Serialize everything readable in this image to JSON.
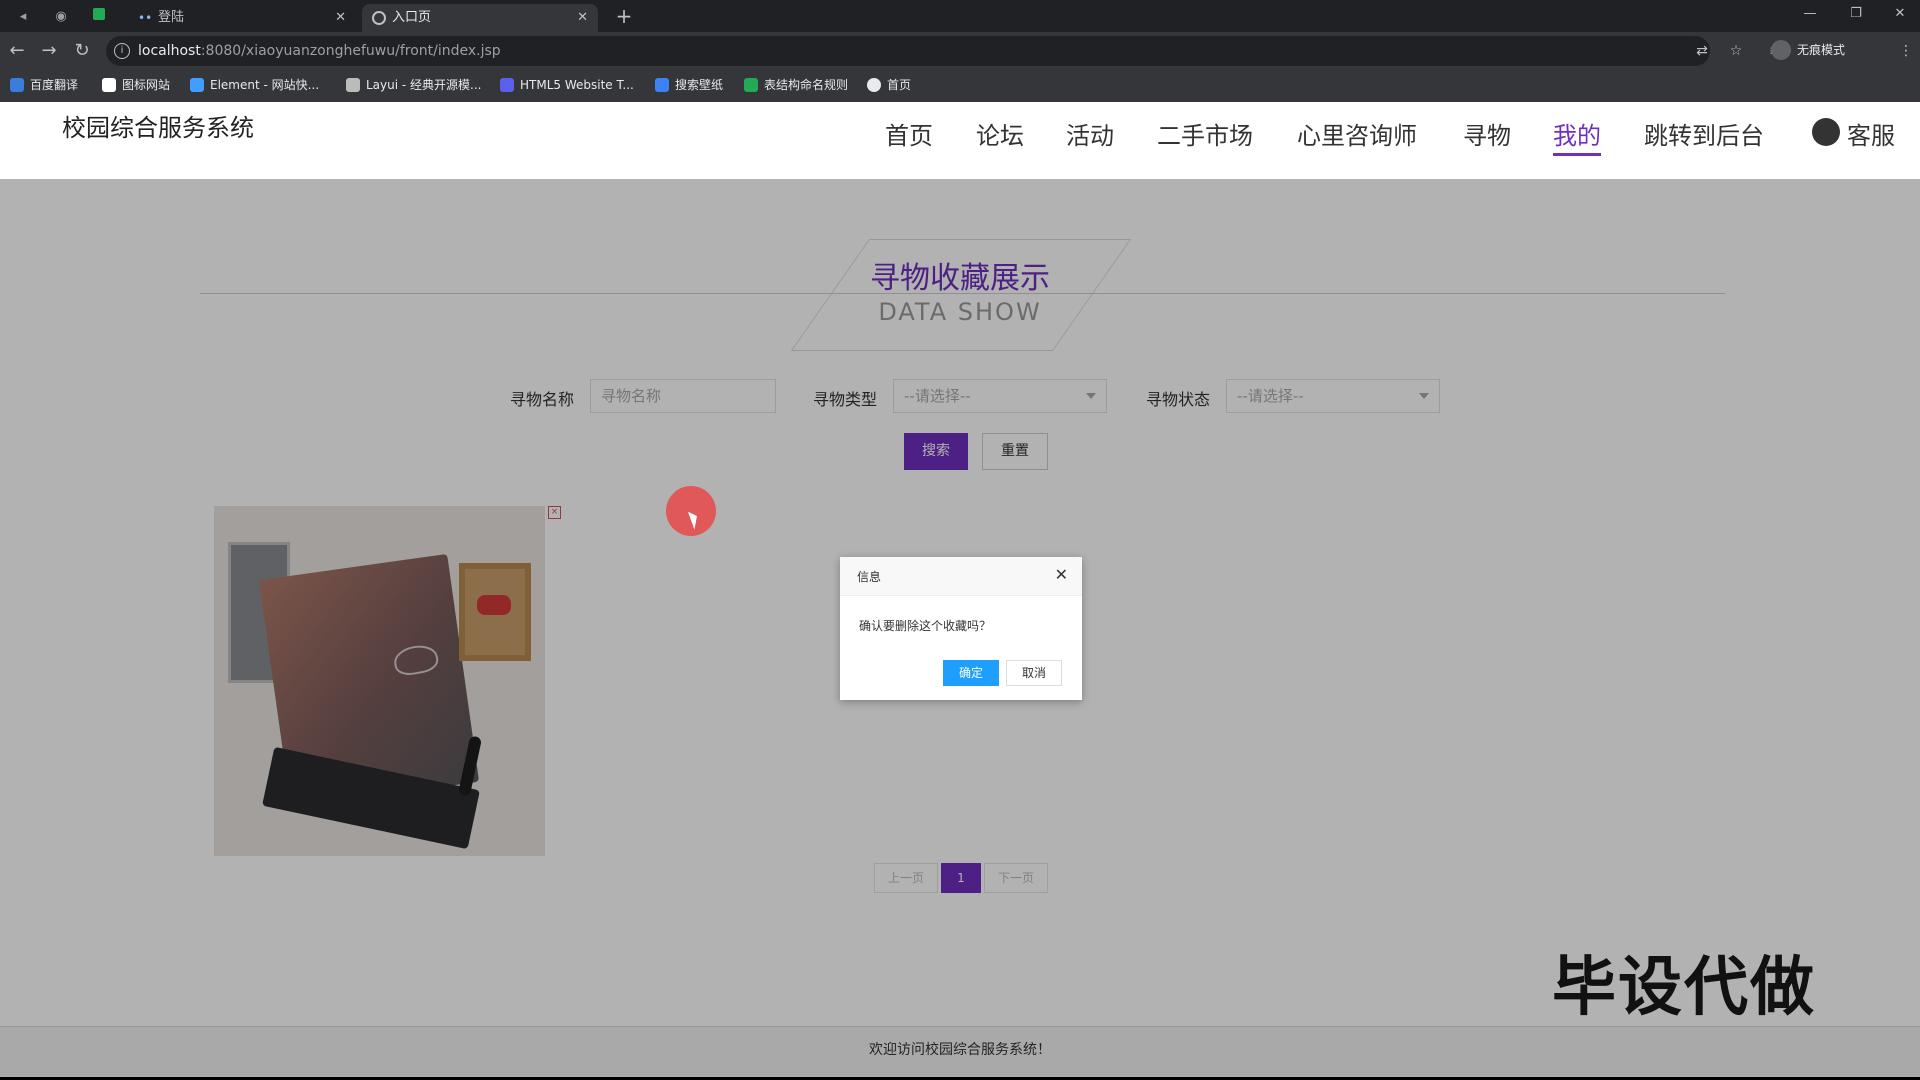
{
  "browser": {
    "tabs": [
      {
        "label": "登陆",
        "active": false
      },
      {
        "label": "入口页",
        "active": true
      }
    ],
    "new_tab_symbol": "+",
    "url_host": "localhost",
    "url_rest": ":8080/xiaoyuanzonghefuwu/front/index.jsp",
    "incognito_label": "无痕模式",
    "bookmarks": [
      {
        "label": "百度翻译",
        "color": "#3b7ddd"
      },
      {
        "label": "图标网站",
        "color": "#ffffff"
      },
      {
        "label": "Element - 网站快...",
        "color": "#409eff"
      },
      {
        "label": "Layui - 经典开源模...",
        "color": "#bbbbbb"
      },
      {
        "label": "HTML5 Website T...",
        "color": "#5d5fef"
      },
      {
        "label": "搜索壁纸",
        "color": "#3b82f6"
      },
      {
        "label": "表结构命名规则",
        "color": "#22aa55"
      },
      {
        "label": "首页",
        "color": "#e8eaed"
      }
    ]
  },
  "site": {
    "title": "校园综合服务系统",
    "nav": [
      {
        "label": "首页",
        "active": false
      },
      {
        "label": "论坛",
        "active": false
      },
      {
        "label": "活动",
        "active": false
      },
      {
        "label": "二手市场",
        "active": false
      },
      {
        "label": "心里咨询师",
        "active": false
      },
      {
        "label": "寻物",
        "active": false
      },
      {
        "label": "我的",
        "active": true
      },
      {
        "label": "跳转到后台",
        "active": false
      },
      {
        "label": "客服",
        "active": false
      }
    ],
    "accent_color": "#6f2fbf"
  },
  "section": {
    "title": "寻物收藏展示",
    "subtitle": "DATA SHOW"
  },
  "filters": {
    "name_label": "寻物名称",
    "name_placeholder": "寻物名称",
    "type_label": "寻物类型",
    "type_value": "--请选择--",
    "status_label": "寻物状态",
    "status_value": "--请选择--",
    "search_label": "搜索",
    "reset_label": "重置"
  },
  "card": {
    "delete_icon": "delete-icon",
    "image": "laptop-photo"
  },
  "pagination": {
    "prev_label": "上一页",
    "current": "1",
    "next_label": "下一页"
  },
  "dialog": {
    "title": "信息",
    "close_symbol": "✕",
    "message": "确认要删除这个收藏吗？",
    "ok_label": "确定",
    "cancel_label": "取消",
    "ok_color": "#1e9fff"
  },
  "footer": {
    "text": "欢迎访问校园综合服务系统！"
  },
  "watermark": {
    "text": "毕设代做"
  }
}
